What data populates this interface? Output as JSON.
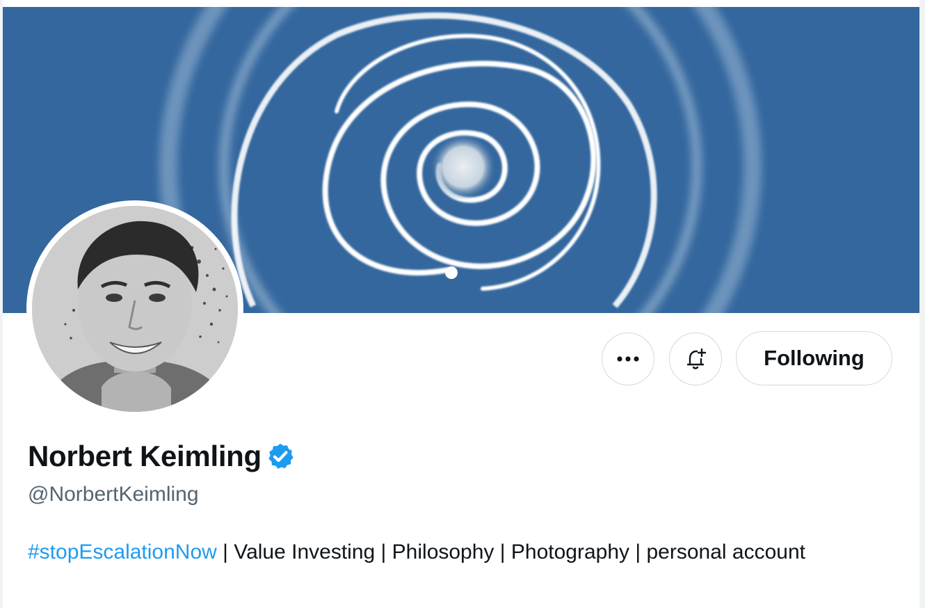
{
  "colors": {
    "banner_bg": "#33679e",
    "spiral": "#ffffff",
    "accent_blue": "#1d9bf0",
    "text_primary": "#0f1419",
    "text_secondary": "#536471",
    "border": "#cfd9de"
  },
  "profile": {
    "display_name": "Norbert Keimling",
    "handle": "@NorbertKeimling",
    "verified": true,
    "bio": {
      "hashtag": "#stopEscalationNow",
      "text": " | Value Investing | Philosophy | Photography | personal account"
    }
  },
  "actions": {
    "more_icon": "more-horizontal-icon",
    "notify_icon": "bell-plus-icon",
    "follow_label": "Following"
  }
}
